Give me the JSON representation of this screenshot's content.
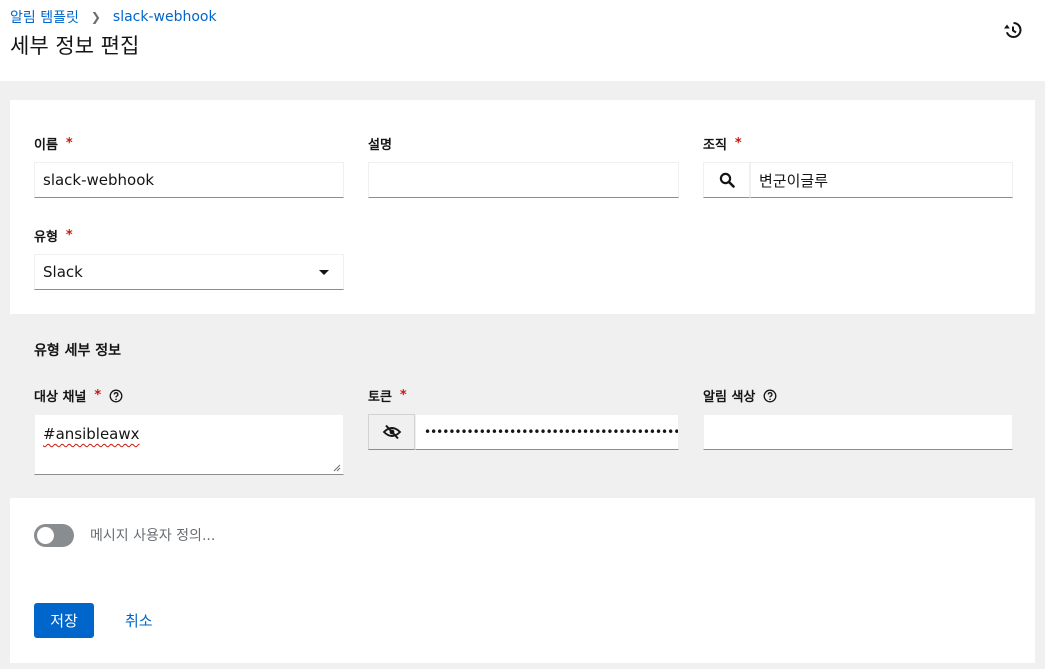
{
  "breadcrumb": {
    "parent": "알림 템플릿",
    "current": "slack-webhook"
  },
  "page": {
    "title": "세부 정보 편집"
  },
  "form": {
    "name": {
      "label": "이름",
      "value": "slack-webhook"
    },
    "description": {
      "label": "설명",
      "value": ""
    },
    "organization": {
      "label": "조직",
      "value": "변군이글루"
    },
    "type": {
      "label": "유형",
      "value": "Slack"
    },
    "type_details": {
      "title": "유형 세부 정보",
      "channels": {
        "label": "대상 채널",
        "value": "#ansibleawx"
      },
      "token": {
        "label": "토큰",
        "value": "••••••••••••••••••••••••••••••••••••••••••••…"
      },
      "color": {
        "label": "알림 색상",
        "value": ""
      }
    },
    "custom_messages": {
      "label": "메시지 사용자 정의...",
      "enabled": false
    }
  },
  "actions": {
    "save": "저장",
    "cancel": "취소"
  },
  "colors": {
    "primary": "#0066cc",
    "required": "#c9190b",
    "toggle_off": "#8a8d90"
  }
}
